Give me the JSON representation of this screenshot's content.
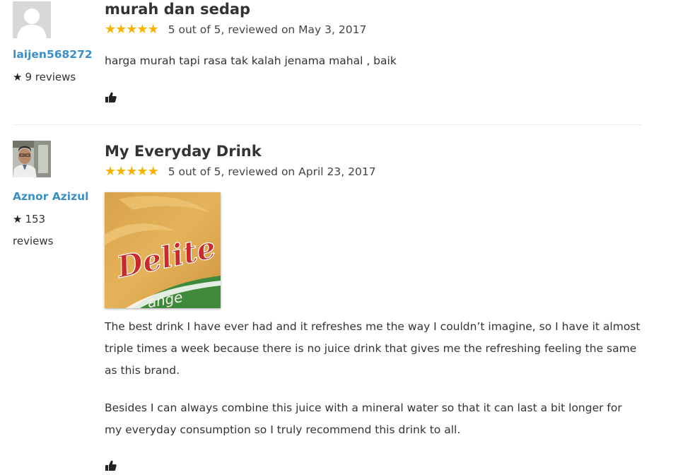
{
  "reviews": [
    {
      "username": "laijen568272",
      "review_count_line1": "9 reviews",
      "review_count_line2": "",
      "title": "murah dan sedap",
      "rating_text": "5 out of 5, reviewed on May 3, 2017",
      "stars": 5,
      "paragraphs": [
        "harga murah tapi rasa tak kalah jenama mahal , baik"
      ]
    },
    {
      "username": "Aznor Azizul",
      "review_count_line1": "153",
      "review_count_line2": "reviews",
      "title": "My Everyday Drink",
      "rating_text": "5 out of 5, reviewed on April 23, 2017",
      "stars": 5,
      "photo": {
        "brand_text": "Delite",
        "sub_text": "ange"
      },
      "paragraphs": [
        "The best drink I have ever had and it refreshes me the way I couldn’t imagine, so I have it almost triple times a week because there is no juice drink that gives me the refreshing feeling the same as this brand.",
        "Besides I can always combine this juice with a mineral water so that it can last a bit longer for my everyday consumption so I truly recommend this drink to all."
      ]
    }
  ],
  "colors": {
    "username": "#3a8fc9",
    "star": "#f6b400",
    "text": "#333333",
    "divider": "#ececec"
  },
  "icons": {
    "rating_star": "star-icon",
    "count_star": "black-star-icon",
    "helpful": "thumbs-up-icon",
    "default_avatar": "user-silhouette-icon"
  }
}
